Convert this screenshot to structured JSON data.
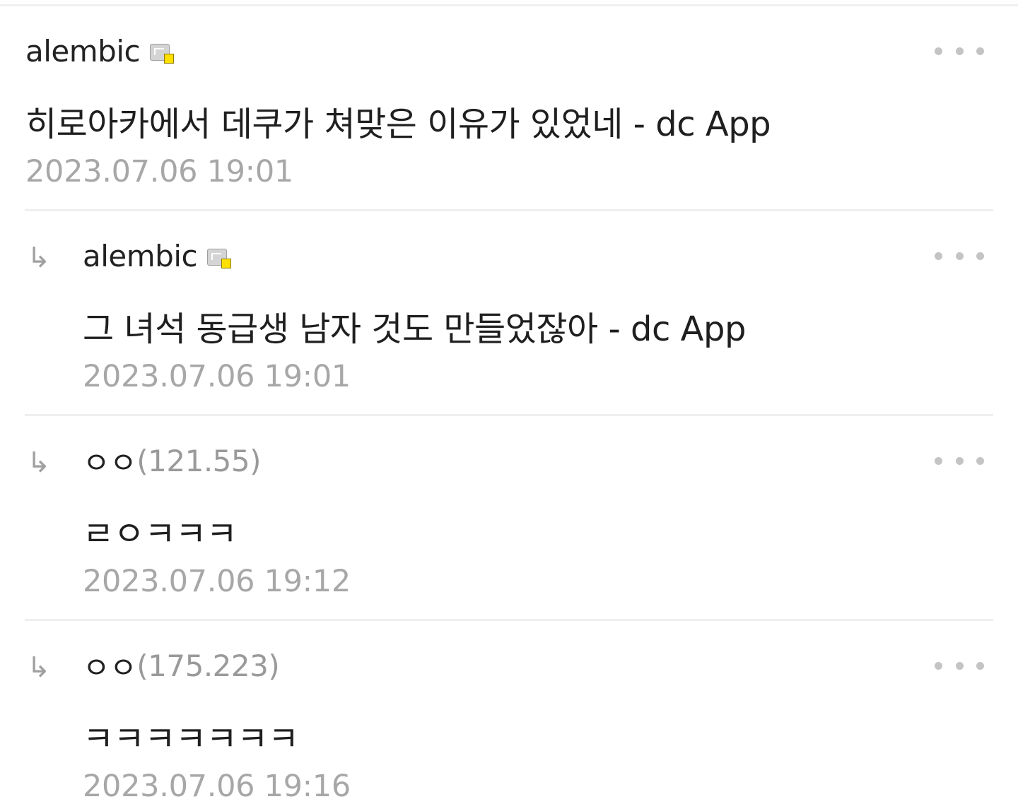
{
  "comments": [
    {
      "author": "alembic",
      "author_ip": "",
      "fixed_nick_icon": "gallery-fixed-nick-icon",
      "content": "히로아카에서 데쿠가 쳐맞은 이유가 있었네 - dc App",
      "date": "2023.07.06 19:01",
      "is_reply": false
    },
    {
      "author": "alembic",
      "author_ip": "",
      "fixed_nick_icon": "gallery-fixed-nick-icon",
      "content": "그 녀석 동급생 남자 것도 만들었잖아 - dc App",
      "date": "2023.07.06 19:01",
      "is_reply": true
    },
    {
      "author": "ㅇㅇ",
      "author_ip": "(121.55)",
      "content": "ㄹㅇㅋㅋㅋ",
      "date": "2023.07.06 19:12",
      "is_reply": true
    },
    {
      "author": "ㅇㅇ",
      "author_ip": "(175.223)",
      "content": "ㅋㅋㅋㅋㅋㅋㅋ",
      "date": "2023.07.06 19:16",
      "is_reply": true
    }
  ],
  "icons": {
    "reply_arrow": "↳",
    "more": "more-dots-icon"
  },
  "colors": {
    "text": "#1f1f1f",
    "meta": "#a7a7a7",
    "ip": "#9a9a9a",
    "divider": "#efefef",
    "badge": "#ffe000"
  }
}
